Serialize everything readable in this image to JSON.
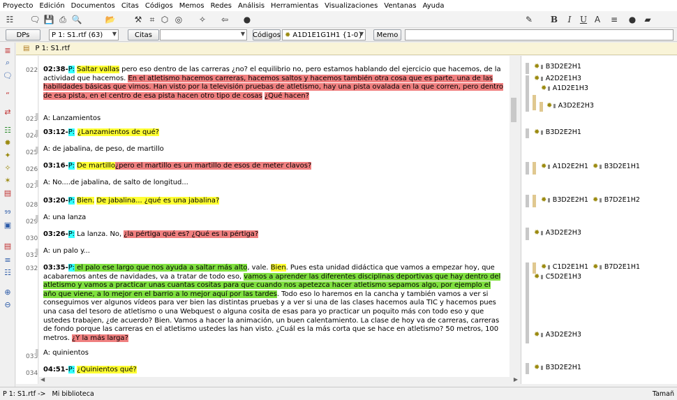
{
  "menu": [
    "Proyecto",
    "Edición",
    "Documentos",
    "Citas",
    "Códigos",
    "Memos",
    "Redes",
    "Análisis",
    "Herramientas",
    "Visualizaciones",
    "Ventanas",
    "Ayuda"
  ],
  "toolbar2": {
    "dps": "DPs",
    "doc_select": "P 1: S1.rtf (63)",
    "citas": "Citas",
    "codigos": "Códigos",
    "code_select": "A1D1E1G1H1 {1-0}",
    "memo": "Memo"
  },
  "doc_tab": "P 1: S1.rtf",
  "line_numbers": [
    "022",
    "023",
    "024",
    "025",
    "026",
    "027",
    "028",
    "029",
    "030",
    "031",
    "032",
    "033",
    "034"
  ],
  "transcript": {
    "p022_time": "02:38-",
    "p022_speaker": "P:",
    "p022_a": "Saltar vallas",
    "p022_b": " pero eso dentro de las carreras ¿no? el equilibrio no, pero estamos hablando del ejercicio que hacemos, de la actividad que hacemos. ",
    "p022_c": "En el atletismo hacemos carreras, hacemos saltos y hacemos también otra cosa que es parte, una de las habilidades básicas que vimos. Han visto por la televisión pruebas de atletismo, hay una pista ovalada en la que corren, pero dentro de esa pista, en el centro de esa pista hacen otro tipo de cosas",
    "p022_d": "¿Qué hacen?",
    "p023": "A: Lanzamientos",
    "p024_time": "03:12-",
    "p024_speaker": "P:",
    "p024_a": "¿Lanzamientos de qué?",
    "p025": "A: de jabalina, de peso, de martillo",
    "p026_time": "03:16-",
    "p026_speaker": "P:",
    "p026_a": "De martillo",
    "p026_b": "¿pero el martillo es un martillo de esos de meter clavos?",
    "p027": "A: No....de jabalina, de salto de longitud...",
    "p028_time": "03:20-",
    "p028_speaker": "P:",
    "p028_a": "Bien.",
    "p028_b": "De jabalina... ¿qué es una jabalina?",
    "p029": "A: una lanza",
    "p030_time": "03:26-",
    "p030_speaker": "P:",
    "p030_a": " La lanza. No, ",
    "p030_b": "¿la pértiga qué es? ¿Qué es la pértiga?",
    "p031": "A: un palo y...",
    "p032_time": "03:35-",
    "p032_speaker": "P:",
    "p032_a": " el palo ese largo que nos ayuda a saltar más alto",
    "p032_b": ", vale. ",
    "p032_c": "Bien",
    "p032_d": ". Pues esta unidad didáctica que vamos a empezar hoy, que acabaremos antes de navidades, va a tratar de todo eso, ",
    "p032_e": "vamos a aprender las diferentes disciplinas deportivas que hay dentro del atletismo y vamos a practicar unas cuantas cositas para que cuando nos apetezca hacer atletismo sepamos algo, por ejemplo el año que viene, a lo mejor en el barrio a lo mejor aquí por las tardes",
    "p032_f": ". Todo eso lo haremos en la cancha y también vamos a ver si conseguimos ver algunos vídeos para ver bien las distintas pruebas y a ver si una de las clases hacemos aula TIC y hacemos pues una casa del tesoro de atletismo o una Webquest o alguna cosita de esas para yo practicar un poquito más con todo eso y que ustedes trabajen, ¿de acuerdo? Bien. Vamos a hacer la animación, un buen calentamiento. La clase de hoy va de carreras, carreras de fondo porque las carreras en el atletismo ustedes las han visto. ¿Cuál es la más corta que se hace en atletismo? 50 metros, 100 metros. ",
    "p032_g": "¿Y la más larga?",
    "p033": "A: quinientos",
    "p034_time": "04:51-",
    "p034_speaker": "P:",
    "p034_a": "¿Quinientos qué?"
  },
  "margin_codes": {
    "c1": "B3D2E2H1",
    "c2": "A2D2E1H3",
    "c3": "A1D2E1H3",
    "c4": "A3D2E2H3",
    "c5": "B3D2E2H1",
    "c6a": "A1D2E2H1",
    "c6b": "B3D2E1H1",
    "c7a": "B3D2E2H1",
    "c7b": "B7D2E1H2",
    "c8": "A3D2E2H3",
    "c9a": "C1D2E1H1",
    "c9b": "B7D2E1H1",
    "c10": "C5D2E1H3",
    "c11": "A3D2E2H3",
    "c12": "B3D2E2H1"
  },
  "status": {
    "left": "P 1: S1.rtf ->   Mi biblioteca",
    "right": "Tamañ"
  },
  "colors": {
    "yellow": "#ffff33",
    "cyan": "#33ffff",
    "red": "#f08080",
    "green": "#80e040"
  }
}
